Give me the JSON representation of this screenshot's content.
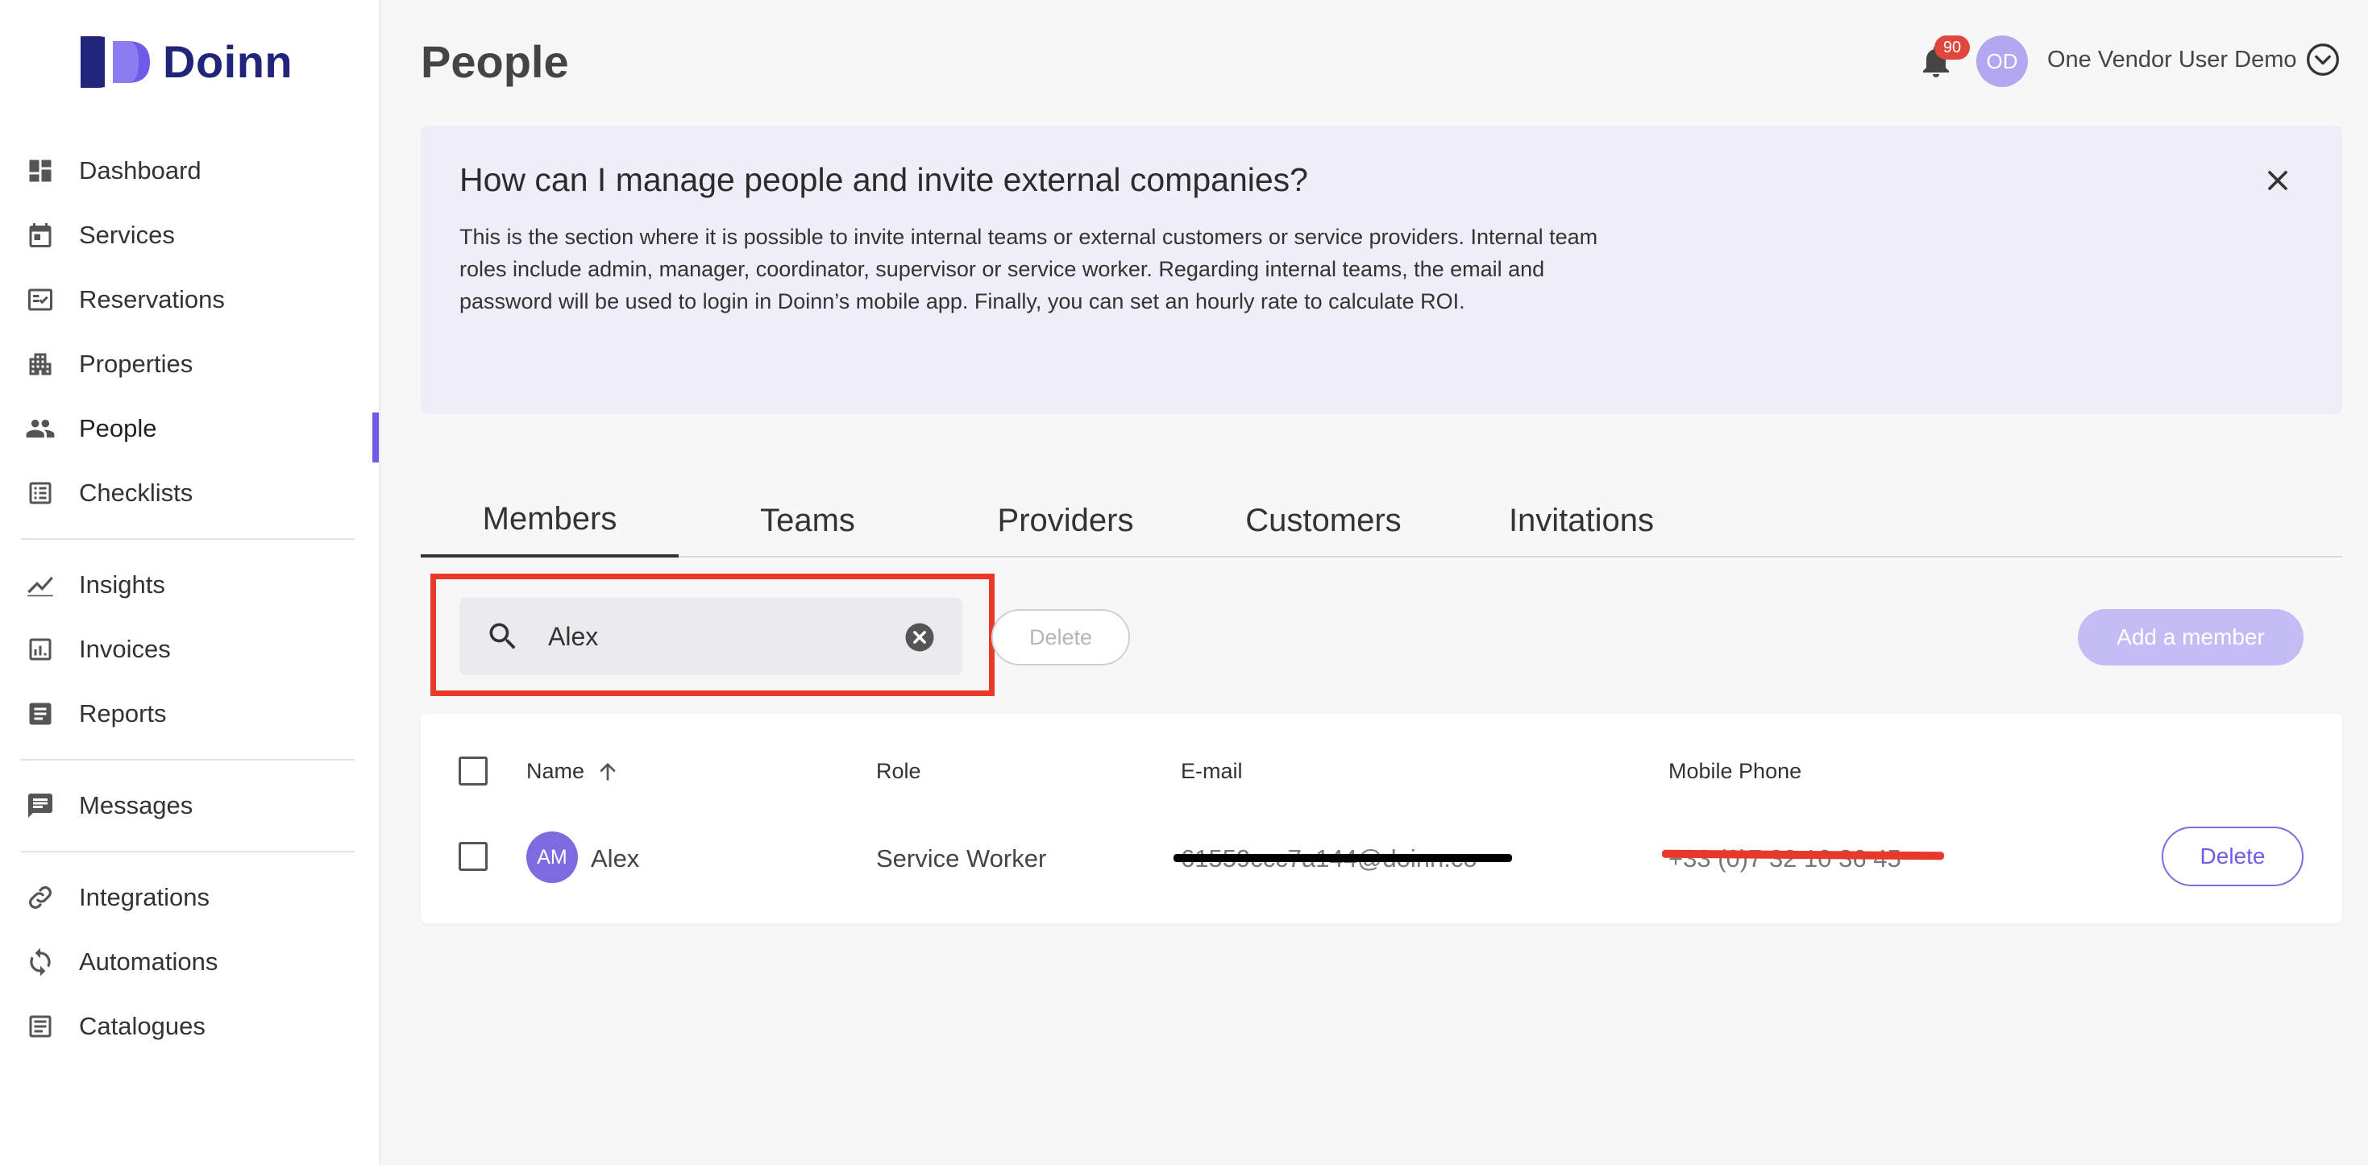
{
  "app": {
    "brand": "Doinn"
  },
  "sidebar": {
    "items": [
      {
        "label": "Dashboard",
        "icon": "dashboard-icon"
      },
      {
        "label": "Services",
        "icon": "calendar-icon"
      },
      {
        "label": "Reservations",
        "icon": "reservations-icon"
      },
      {
        "label": "Properties",
        "icon": "building-icon"
      },
      {
        "label": "People",
        "icon": "people-icon",
        "active": true
      },
      {
        "label": "Checklists",
        "icon": "checklist-icon"
      },
      {
        "label": "Insights",
        "icon": "chart-line-icon"
      },
      {
        "label": "Invoices",
        "icon": "invoice-icon"
      },
      {
        "label": "Reports",
        "icon": "report-icon"
      },
      {
        "label": "Messages",
        "icon": "message-icon"
      },
      {
        "label": "Integrations",
        "icon": "link-icon"
      },
      {
        "label": "Automations",
        "icon": "sync-icon"
      },
      {
        "label": "Catalogues",
        "icon": "catalogue-icon"
      }
    ]
  },
  "header": {
    "title": "People",
    "notifications_count": "90",
    "user_initials": "OD",
    "user_name": "One Vendor User Demo"
  },
  "banner": {
    "title": "How can I manage people and invite external companies?",
    "body": "This is the section where it is possible to invite internal teams or external customers or service providers. Internal team roles include admin, manager, coordinator, supervisor or service worker. Regarding internal teams, the email and password will be used to login in Doinn’s mobile app. Finally, you can set an hourly rate to calculate ROI."
  },
  "tabs": [
    {
      "label": "Members",
      "active": true
    },
    {
      "label": "Teams"
    },
    {
      "label": "Providers"
    },
    {
      "label": "Customers"
    },
    {
      "label": "Invitations"
    }
  ],
  "toolbar": {
    "search_value": "Alex",
    "delete_label": "Delete",
    "add_label": "Add a member"
  },
  "table": {
    "columns": [
      "Name",
      "Role",
      "E-mail",
      "Mobile Phone"
    ],
    "rows": [
      {
        "initials": "AM",
        "name": "Alex",
        "role": "Service Worker",
        "email": "61559ccc7a144@doinn.co",
        "phone": "+33 (0)7 32 10 36 45",
        "delete_label": "Delete"
      }
    ]
  },
  "colors": {
    "accent": "#6e5ce8",
    "brand_dark": "#21257a",
    "banner_bg": "#efeef8",
    "highlight": "#e8392b",
    "badge": "#e0463c"
  }
}
